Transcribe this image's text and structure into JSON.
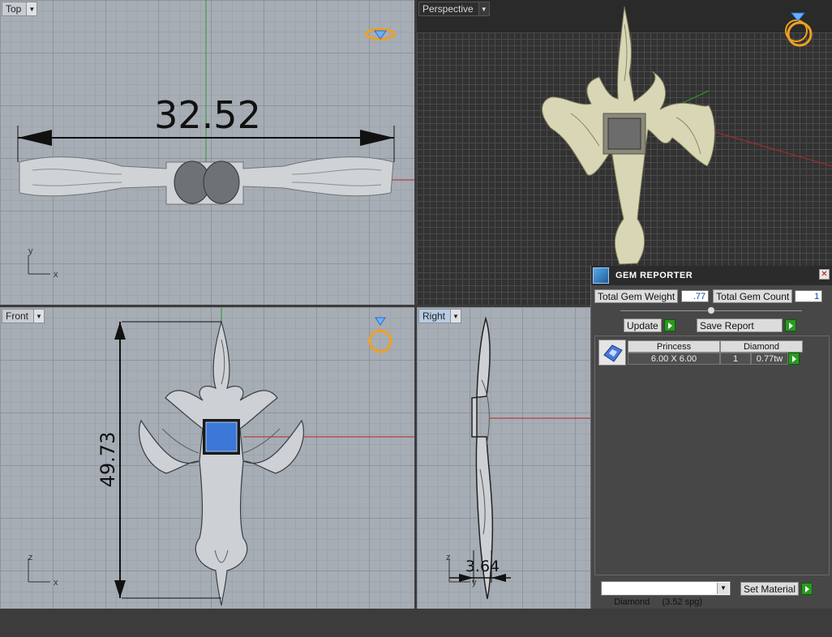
{
  "viewports": {
    "top": {
      "label": "Top",
      "dimension": "32.52",
      "axis_y": "y",
      "axis_x": "x"
    },
    "perspective": {
      "label": "Perspective"
    },
    "front": {
      "label": "Front",
      "dimension": "49.73",
      "axis_y": "z",
      "axis_x": "x"
    },
    "right": {
      "label": "Right",
      "dimension": "3.64",
      "axis_y": "z",
      "axis_x": "y"
    }
  },
  "gem_reporter": {
    "title": "GEM REPORTER",
    "close": "✕",
    "total_weight_label": "Total Gem Weight",
    "total_weight_value": ".77",
    "total_count_label": "Total Gem Count",
    "total_count_value": "1",
    "update_label": "Update",
    "save_report_label": "Save Report",
    "table": {
      "headers": [
        "Princess",
        "Diamond"
      ],
      "row": {
        "size": "6.00 X 6.00",
        "count": "1",
        "weight": "0.77tw"
      }
    },
    "material_select": "Diamond     (3.52 spg)",
    "set_material_label": "Set Material"
  },
  "colors": {
    "accent_green": "#2a9a20",
    "gem_blue": "#3c78d8",
    "ring_gold": "#f0a020",
    "axis_red": "#b82828",
    "axis_green": "#28a028"
  }
}
